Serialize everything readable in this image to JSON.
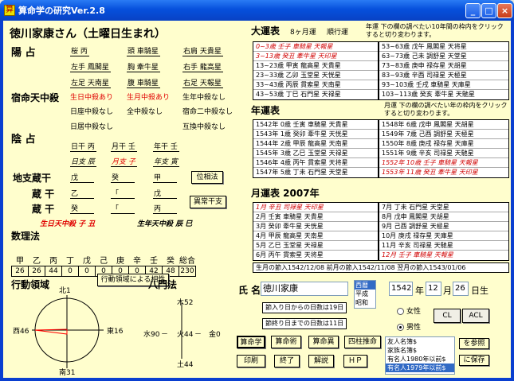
{
  "window": {
    "title": "算命学の研究Ver.2.8",
    "icon": "app-icon",
    "minimize": "_",
    "maximize": "□",
    "close": "×"
  },
  "person": {
    "heading": "徳川家康さん（土曜日生まれ）"
  },
  "yousen": {
    "label": "陽 占",
    "cells": [
      "桜 丙",
      "頭 車騎星",
      "右肩 天貴星",
      "左手 鳳閣星",
      "胸 牽牛星",
      "右手 龍高星",
      "左足 天南星",
      "腹 車騎星",
      "右足 天報星"
    ]
  },
  "shukumei": {
    "label": "宿命天中殺",
    "cells": [
      "生日中殺あり",
      "生月中殺あり",
      "生年中殺なし",
      "日座中殺なし",
      "全中殺なし",
      "宿命二中殺なし",
      "日居中殺なし",
      "",
      "互換中殺なし"
    ]
  },
  "insen": {
    "label": "陰 占",
    "row1": [
      "日干 丙",
      "月干 壬",
      "年干 壬"
    ],
    "row2": [
      "日支 辰",
      "月支 子",
      "年支 寅"
    ],
    "chishi_label": "地支蔵干",
    "chishi": [
      "戊",
      "癸",
      "甲"
    ],
    "zoukan_label1": "蔵 干",
    "zoukan1": [
      "乙",
      "「",
      "戊"
    ],
    "zoukan_label2": "蔵 干",
    "zoukan2": [
      "癸",
      "「",
      "丙"
    ],
    "btn_isou": "位相法",
    "btn_ijou": "異常干支"
  },
  "tenchusatsu": {
    "seijitsu": "生日天中殺 子 丑",
    "seinen": "生年天中殺 辰 巳"
  },
  "suriho": {
    "label": "数理法",
    "headers": [
      "甲",
      "乙",
      "丙",
      "丁",
      "戊",
      "己",
      "庚",
      "辛",
      "壬",
      "癸",
      "総合"
    ],
    "values": [
      "26",
      "26",
      "44",
      "0",
      "0",
      "0",
      "0",
      "0",
      "42",
      "48",
      "230"
    ]
  },
  "koudou": {
    "label": "行動領域",
    "btn": "行動領域による相性",
    "north": "北1",
    "west": "西46",
    "east": "東16",
    "south": "南31"
  },
  "hachimon": {
    "label": "八門法",
    "top": "木52",
    "left": "水90",
    "center": "火44",
    "right": "金0",
    "bottom": "土44"
  },
  "taiun": {
    "label": "大運表",
    "sub1": "8ヶ月運",
    "sub2": "順行運",
    "note": "年運 下の欄の調べたい10年間の枠内をクリックすると切り変わります。",
    "left": [
      "0~3歳 壬子 車騎星 天報星",
      "3~13歳 癸丑 牽牛星 天印星",
      "13~23歳 甲寅 龍高星 天貴星",
      "23~33歳 乙卯 玉堂星 天恍星",
      "33~43歳 丙辰 貫索星 天南星",
      "43~53歳 丁巳 石門星 天禄星"
    ],
    "right": [
      "53~63歳 戊午 鳳閣星 天将星",
      "63~73歳 己未 調舒星 天堂星",
      "73~83歳 庚申 禄存星 天胡星",
      "83~93歳 辛酉 司禄星 天極星",
      "93~103歳 壬戌 車騎星 天庫星",
      "103~113歳 癸亥 牽牛星 天馳星"
    ]
  },
  "nenun": {
    "label": "年運表",
    "note": "月運 下の欄の調べたい年の枠内をクリックすると切り変わります。",
    "left": [
      "1542年 0歳 壬寅 車騎星 天貴星",
      "1543年 1歳 癸卯 牽牛星 天恍星",
      "1544年 2歳 甲辰 龍高星 天南星",
      "1545年 3歳 乙巳 玉堂星 天禄星",
      "1546年 4歳 丙午 貫索星 天将星",
      "1547年 5歳 丁未 石門星 天堂星"
    ],
    "right": [
      "1548年 6歳 戊申 鳳閣星 天胡星",
      "1549年 7歳 己酉 調舒星 天極星",
      "1550年 8歳 庚戌 禄存星 天庫星",
      "1551年 9歳 辛亥 司禄星 天馳星",
      "1552年 10歳 壬子 車騎星 天報星",
      "1553年 11歳 癸丑 牽牛星 天印星"
    ]
  },
  "getsuun": {
    "label": "月運表 2007年",
    "left": [
      "1月 辛丑 司禄星 天印星",
      "2月 壬寅 車騎星 天貴星",
      "3月 癸卯 牽牛星 天恍星",
      "4月 甲辰 龍高星 天南星",
      "5月 乙巳 玉堂星 天禄星",
      "6月 丙午 貫索星 天将星"
    ],
    "right": [
      "7月 丁未 石門星 天堂星",
      "8月 戊申 鳳閣星 天胡星",
      "9月 己酉 調舒星 天極星",
      "10月 庚戌 禄存星 天庫星",
      "11月 辛亥 司禄星 天馳星",
      "12月 壬子 車騎星 天報星"
    ],
    "status": "生月の節入1542/12/08 前月の節入1542/11/08 翌月の節入1543/01/06"
  },
  "form": {
    "name_label": "氏 名",
    "name_value": "徳川家康",
    "era_options": [
      "西暦",
      "平成",
      "昭和"
    ],
    "year": "1542",
    "year_unit": "年",
    "month": "12",
    "month_unit": "月",
    "day": "26",
    "day_unit": "日生",
    "days_from_sekiiri": "節入り日からの日数は19日",
    "days_to_sekiiri": "節終り日までの日数は11日",
    "female": "女性",
    "male": "男性",
    "btn_cl": "CL",
    "btn_acl": "ACL"
  },
  "buttons": {
    "sanmeigaku": "算命学",
    "sanmeijutsu": "算命術",
    "sanmeiku": "算命異",
    "shichusuimei": "四柱推命",
    "print": "印刷",
    "exit": "終了",
    "kaisetsu": "解説",
    "hp": "ＨＰ",
    "sansho": "を参照",
    "hozon": "に保存"
  },
  "list": [
    "友人名簿$",
    "家族名簿$",
    "有名人1980年以前$",
    "有名人1979年以前$"
  ]
}
